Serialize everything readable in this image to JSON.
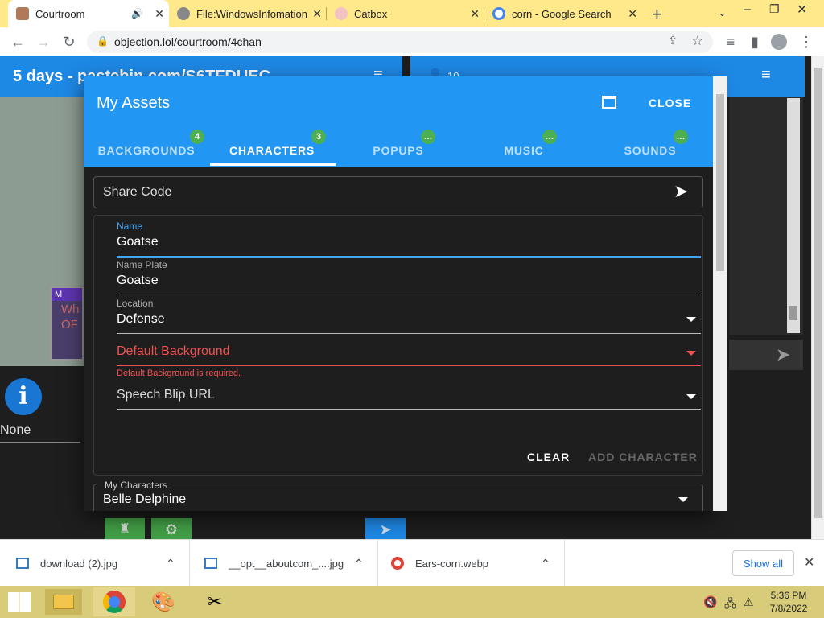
{
  "browser": {
    "tabs": [
      {
        "title": "Courtroom",
        "active": true
      },
      {
        "title": "File:WindowsInfomation",
        "active": false
      },
      {
        "title": "Catbox",
        "active": false
      },
      {
        "title": "corn - Google Search",
        "active": false
      }
    ],
    "url": "objection.lol/courtroom/4chan",
    "new_tab_icon": "plus-icon"
  },
  "background_page": {
    "header_title": "5 days - pastebin.com/S6TFDUEC",
    "user_count": "10",
    "none_label": "None",
    "card_lines": [
      "M",
      "Wh",
      "OF"
    ]
  },
  "modal": {
    "title": "My Assets",
    "close_label": "CLOSE",
    "tabs": [
      {
        "label": "BACKGROUNDS",
        "badge": "4"
      },
      {
        "label": "CHARACTERS",
        "badge": "3"
      },
      {
        "label": "POPUPS",
        "badge": "…"
      },
      {
        "label": "MUSIC",
        "badge": "…"
      },
      {
        "label": "SOUNDS",
        "badge": "…"
      }
    ],
    "active_tab": "CHARACTERS",
    "share_code_placeholder": "Share Code",
    "form": {
      "name_label": "Name",
      "name_value": "Goatse",
      "nameplate_label": "Name Plate",
      "nameplate_value": "Goatse",
      "location_label": "Location",
      "location_value": "Defense",
      "default_bg_label": "Default Background",
      "default_bg_error": "Default Background is required.",
      "speech_blip_label": "Speech Blip URL",
      "clear_label": "CLEAR",
      "add_label": "ADD CHARACTER"
    },
    "my_characters_label": "My Characters",
    "my_characters_value": "Belle Delphine"
  },
  "downloads": {
    "items": [
      "download (2).jpg",
      "__opt__aboutcom_....jpg",
      "Ears-corn.webp"
    ],
    "show_all_label": "Show all"
  },
  "taskbar": {
    "time": "5:36 PM",
    "date": "7/8/2022"
  },
  "colors": {
    "accent": "#2196f3",
    "badge": "#4caf50",
    "error": "#ef5350",
    "tabstrip": "#ffe98a"
  }
}
